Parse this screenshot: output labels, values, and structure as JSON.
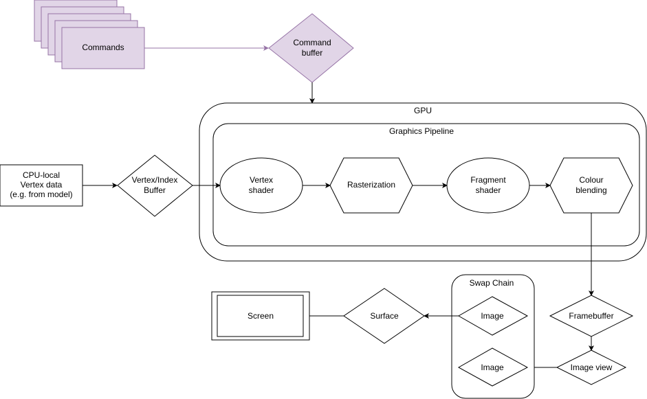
{
  "colors": {
    "purple_fill": "#e1d5e7",
    "purple_stroke": "#9673a6",
    "stroke": "#000000"
  },
  "nodes": {
    "commands": "Commands",
    "command_buffer": [
      "Command",
      "buffer"
    ],
    "gpu": "GPU",
    "graphics_pipeline": "Graphics Pipeline",
    "cpu_vertex_data": [
      "CPU-local",
      "Vertex data",
      "(e.g. from model)"
    ],
    "vertex_index_buffer": [
      "Vertex/Index",
      "Buffer"
    ],
    "vertex_shader": [
      "Vertex",
      "shader"
    ],
    "rasterization": "Rasterization",
    "fragment_shader": [
      "Fragment",
      "shader"
    ],
    "colour_blending": [
      "Colour",
      "blending"
    ],
    "framebuffer": "Framebuffer",
    "image_view": "Image view",
    "swap_chain": "Swap Chain",
    "swap_image_1": "Image",
    "swap_image_2": "Image",
    "surface": "Surface",
    "screen": "Screen"
  }
}
